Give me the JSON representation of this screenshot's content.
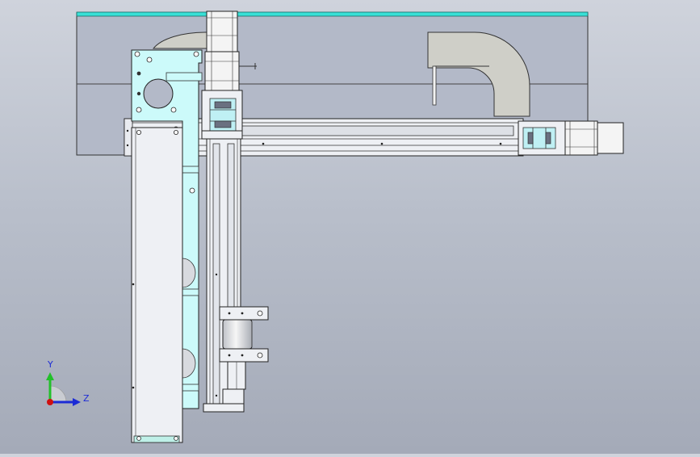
{
  "viewport": {
    "background_top": "#cfd3dc",
    "background_bottom": "#a4aab8"
  },
  "triad": {
    "y_label": "Y",
    "z_label": "Z",
    "y_color": "#22c02a",
    "z_color": "#1c2bd6",
    "origin_color": "#d01010"
  },
  "colors": {
    "edge": "#222222",
    "part_fill": "#eef0f4",
    "plate_cyan": "#ccfafa",
    "top_strip": "#38e0d6",
    "frame_fill": "#b3b9c8",
    "cable_fill": "#cfcfc8",
    "motor_fill": "#f4f4f4",
    "coupling_cyan": "#bff0f4"
  },
  "icons": [
    "cad-viewport",
    "axis-triad-icon"
  ]
}
